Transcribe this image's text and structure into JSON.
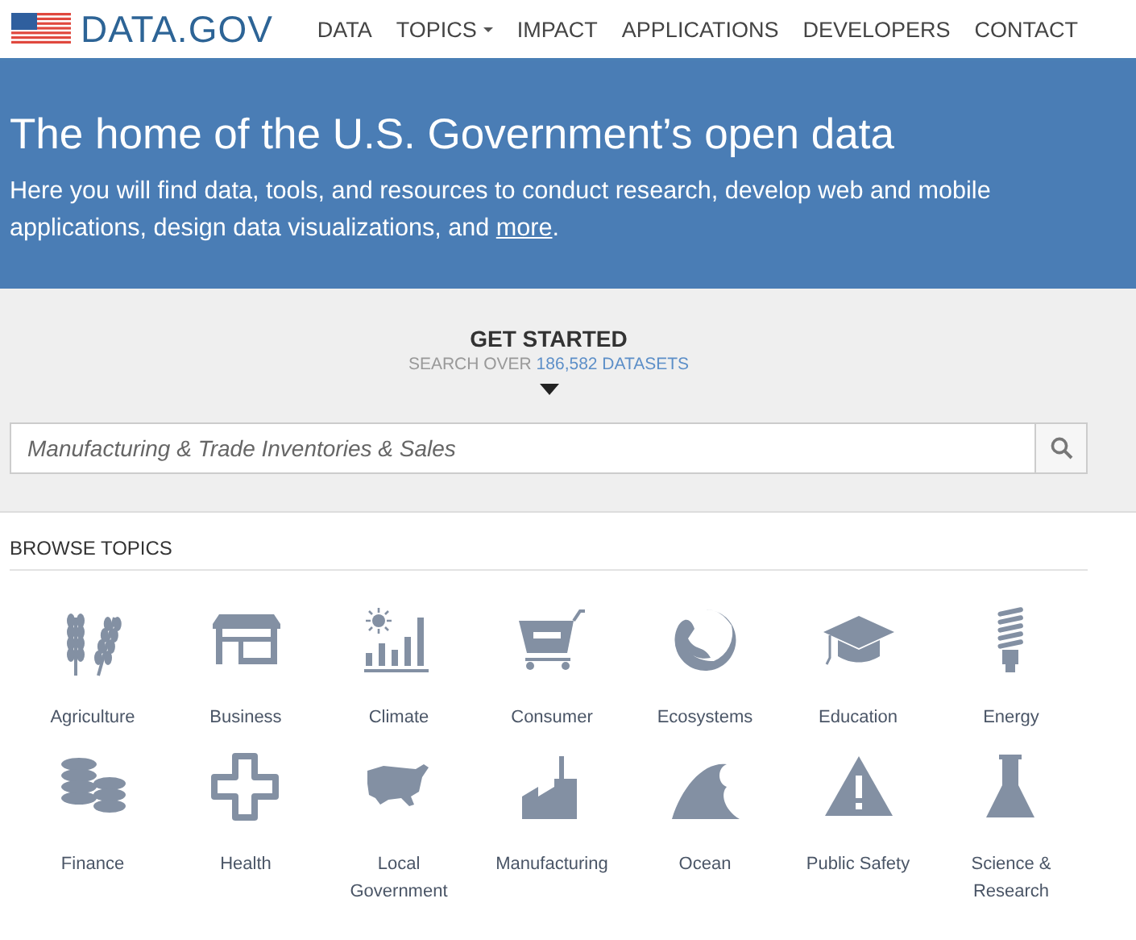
{
  "header": {
    "logo": "DATA.GOV",
    "nav": [
      {
        "label": "DATA",
        "dropdown": false
      },
      {
        "label": "TOPICS",
        "dropdown": true
      },
      {
        "label": "IMPACT",
        "dropdown": false
      },
      {
        "label": "APPLICATIONS",
        "dropdown": false
      },
      {
        "label": "DEVELOPERS",
        "dropdown": false
      },
      {
        "label": "CONTACT",
        "dropdown": false
      }
    ]
  },
  "hero": {
    "title": "The home of the U.S. Government’s open data",
    "text": "Here you will find data, tools, and resources to conduct research, develop web and mobile applications, design data visualizations, and",
    "link": "more",
    "text_end": "."
  },
  "search": {
    "heading": "GET STARTED",
    "subheading": "SEARCH OVER",
    "count": "186,582 DATASETS",
    "placeholder": "Manufacturing & Trade Inventories & Sales"
  },
  "topics": {
    "heading": "BROWSE TOPICS",
    "items": [
      {
        "label": "Agriculture"
      },
      {
        "label": "Business"
      },
      {
        "label": "Climate"
      },
      {
        "label": "Consumer"
      },
      {
        "label": "Ecosystems"
      },
      {
        "label": "Education"
      },
      {
        "label": "Energy"
      },
      {
        "label": "Finance"
      },
      {
        "label": "Health"
      },
      {
        "label": "Local Government"
      },
      {
        "label": "Manufacturing"
      },
      {
        "label": "Ocean"
      },
      {
        "label": "Public Safety"
      },
      {
        "label": "Science & Research"
      }
    ]
  }
}
